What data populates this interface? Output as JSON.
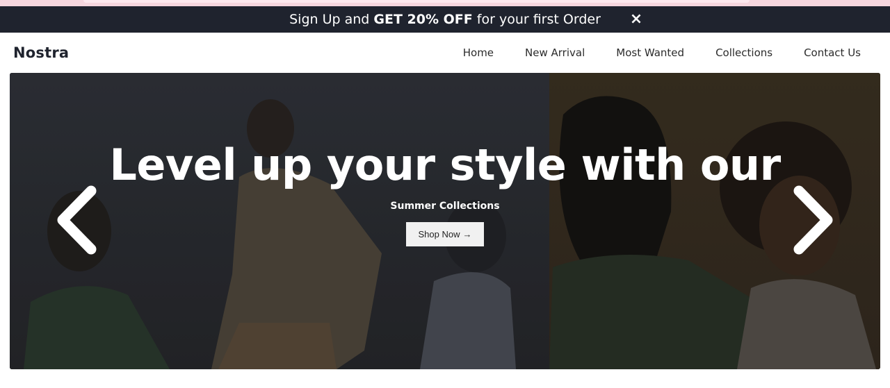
{
  "promo": {
    "text_before": "Sign Up and ",
    "text_bold": "GET 20% OFF",
    "text_after": " for your first Order",
    "close_icon": "×"
  },
  "nav": {
    "logo": "Nostra",
    "links": [
      "Home",
      "New Arrival",
      "Most Wanted",
      "Collections",
      "Contact Us"
    ]
  },
  "hero": {
    "title": "Level up your style with our",
    "subtitle": "Summer Collections",
    "button_label": "Shop Now",
    "button_icon": "→",
    "prev_icon": "chevron-left-icon",
    "next_icon": "chevron-right-icon"
  },
  "colors": {
    "promo_bg": "#1f232e",
    "top_strip": "#f6d6de",
    "text_dark": "#1f232e"
  }
}
